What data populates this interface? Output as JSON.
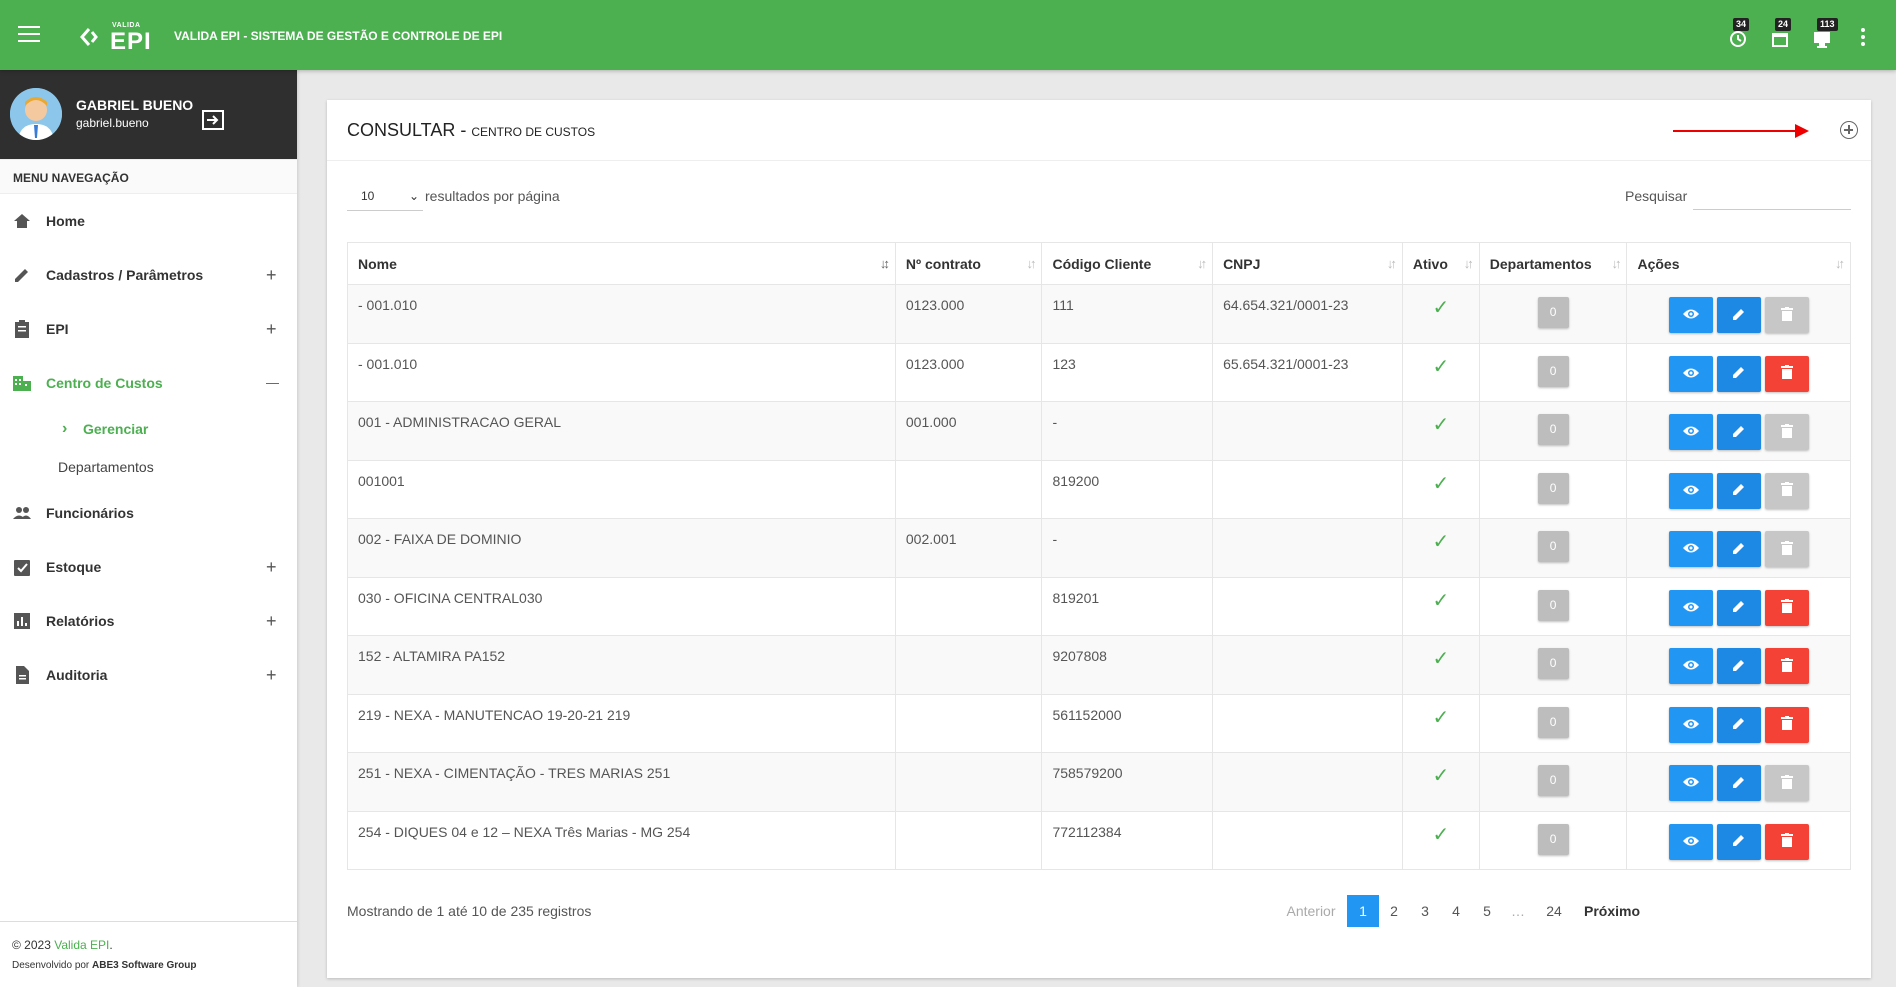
{
  "app": {
    "logo_small": "VALIDA",
    "logo_big": "EPI",
    "title": "VALIDA EPI - SISTEMA DE GESTÃO E CONTROLE DE EPI",
    "badges": [
      "34",
      "24",
      "113"
    ],
    "accent": "#4caf50"
  },
  "user": {
    "name": "GABRIEL BUENO",
    "login": "gabriel.bueno"
  },
  "sidebar": {
    "header": "MENU NAVEGAÇÃO",
    "items": [
      {
        "label": "Home",
        "icon": "home-icon"
      },
      {
        "label": "Cadastros / Parâmetros",
        "icon": "pencil-icon",
        "exp": "+"
      },
      {
        "label": "EPI",
        "icon": "clipboard-icon",
        "exp": "+"
      },
      {
        "label": "Centro de Custos",
        "icon": "building-icon",
        "exp": "—"
      },
      {
        "label": "Funcionários",
        "icon": "people-icon"
      },
      {
        "label": "Estoque",
        "icon": "checklist-icon",
        "exp": "+"
      },
      {
        "label": "Relatórios",
        "icon": "bar-chart-icon",
        "exp": "+"
      },
      {
        "label": "Auditoria",
        "icon": "document-icon",
        "exp": "+"
      }
    ],
    "sub_items": [
      "Gerenciar",
      "Departamentos"
    ],
    "footer_copy": "© 2023 ",
    "footer_brand": "Valida EPI",
    "footer_dot": ".",
    "footer_dev_prefix": "Desenvolvido por ",
    "footer_dev_company": "ABE3 Software Group"
  },
  "page": {
    "title": "CONSULTAR - ",
    "subtitle": "CENTRO DE CUSTOS",
    "length_value": "10",
    "length_label": "resultados por página",
    "search_label": "Pesquisar",
    "search_value": ""
  },
  "table": {
    "columns": [
      "Nome",
      "Nº contrato",
      "Código Cliente",
      "CNPJ",
      "Ativo",
      "Departamentos",
      "Ações"
    ],
    "rows": [
      {
        "nome": "- 001.010",
        "contrato": "0123.000",
        "codigo": "111",
        "cnpj": "64.654.321/0001-23",
        "dept": "0",
        "can_delete": false
      },
      {
        "nome": "- 001.010",
        "contrato": "0123.000",
        "codigo": "123",
        "cnpj": "65.654.321/0001-23",
        "dept": "0",
        "can_delete": true
      },
      {
        "nome": "001 - ADMINISTRACAO GERAL",
        "contrato": "001.000",
        "codigo": "-",
        "cnpj": "",
        "dept": "0",
        "can_delete": false
      },
      {
        "nome": "001001",
        "contrato": "",
        "codigo": "819200",
        "cnpj": "",
        "dept": "0",
        "can_delete": false
      },
      {
        "nome": "002 - FAIXA DE DOMINIO",
        "contrato": "002.001",
        "codigo": "-",
        "cnpj": "",
        "dept": "0",
        "can_delete": false
      },
      {
        "nome": "030 - OFICINA CENTRAL030",
        "contrato": "",
        "codigo": "819201",
        "cnpj": "",
        "dept": "0",
        "can_delete": true
      },
      {
        "nome": "152 - ALTAMIRA PA152",
        "contrato": "",
        "codigo": "9207808",
        "cnpj": "",
        "dept": "0",
        "can_delete": true
      },
      {
        "nome": "219 - NEXA - MANUTENCAO 19-20-21 219",
        "contrato": "",
        "codigo": "561152000",
        "cnpj": "",
        "dept": "0",
        "can_delete": true
      },
      {
        "nome": "251 - NEXA - CIMENTAÇÃO - TRES MARIAS 251",
        "contrato": "",
        "codigo": "758579200",
        "cnpj": "",
        "dept": "0",
        "can_delete": false
      },
      {
        "nome": "254 - DIQUES 04 e 12 – NEXA Três Marias - MG 254",
        "contrato": "",
        "codigo": "772112384",
        "cnpj": "",
        "dept": "0",
        "can_delete": true
      }
    ]
  },
  "footer_info": "Mostrando de 1 até 10 de 235 registros",
  "pagination": {
    "prev": "Anterior",
    "pages": [
      "1",
      "2",
      "3",
      "4",
      "5",
      "…",
      "24"
    ],
    "next": "Próximo"
  }
}
